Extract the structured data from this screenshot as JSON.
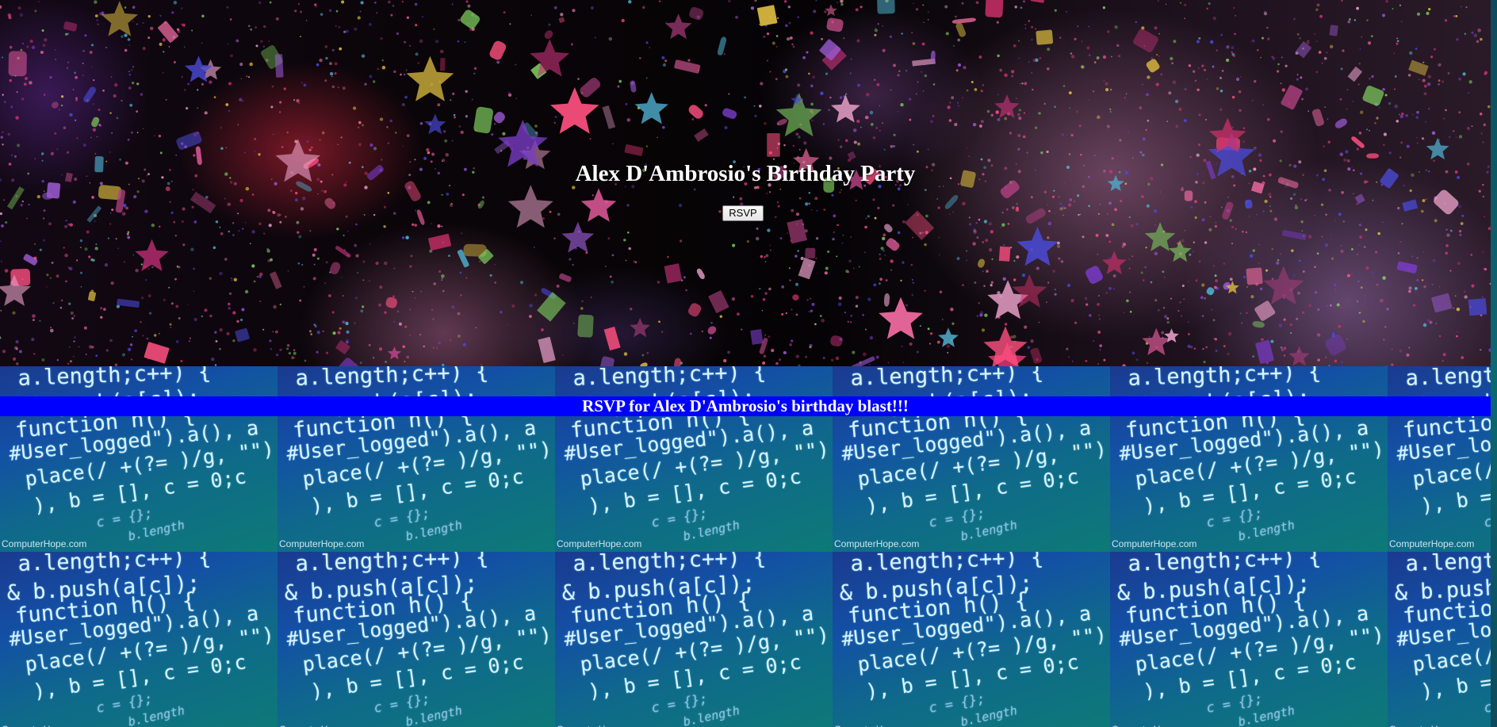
{
  "hero": {
    "title": "Alex D'Ambrosio's Birthday Party",
    "rsvp_button_label": "RSVP"
  },
  "banner": {
    "text": "RSVP for Alex D'Ambrosio's birthday blast!!!"
  },
  "code_tile": {
    "lines": [
      "a.length;c++) {",
      "& b.push(a[c]);",
      "function h() {",
      "#User_logged\").a(), a",
      "place(/ +(?= )/g, \"\"),",
      "), b = [], c = 0;c",
      "c = {};",
      "b.length"
    ],
    "watermark": "ComputerHope.com"
  },
  "colors": {
    "banner_bg": "#0000ff",
    "title_text": "#ffffff",
    "banner_text": "#ffffff"
  }
}
